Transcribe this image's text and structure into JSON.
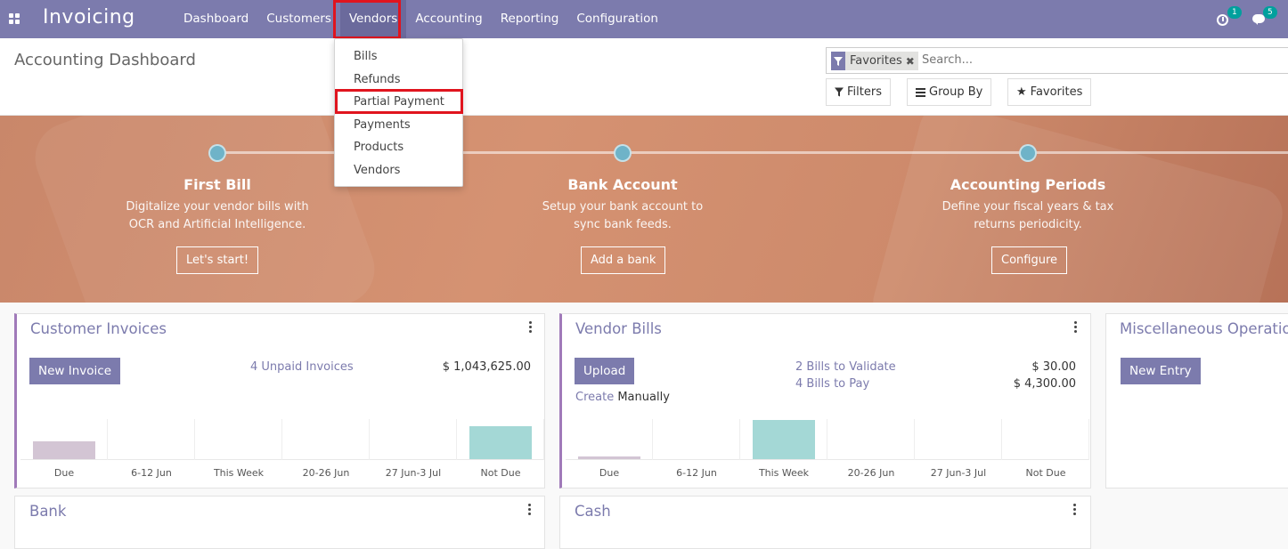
{
  "app": {
    "title": "Invoicing"
  },
  "nav": {
    "menus": [
      "Dashboard",
      "Customers",
      "Vendors",
      "Accounting",
      "Reporting",
      "Configuration"
    ],
    "activities_count": "1",
    "messages_count": "5"
  },
  "vendors_menu": {
    "items": [
      "Bills",
      "Refunds",
      "Partial Payment",
      "Payments",
      "Products",
      "Vendors"
    ]
  },
  "control_panel": {
    "title": "Accounting Dashboard",
    "facet": "Favorites",
    "search_placeholder": "Search...",
    "filters_label": "Filters",
    "groupby_label": "Group By",
    "favorites_label": "Favorites"
  },
  "onboarding": {
    "steps": [
      {
        "title": "First Bill",
        "desc1": "Digitalize your vendor bills with",
        "desc2": "OCR and Artificial Intelligence.",
        "button": "Let's start!"
      },
      {
        "title": "Bank Account",
        "desc1": "Setup your bank account to",
        "desc2": "sync bank feeds.",
        "button": "Add a bank"
      },
      {
        "title": "Accounting Periods",
        "desc1": "Define your fiscal years & tax",
        "desc2": "returns periodicity.",
        "button": "Configure"
      }
    ]
  },
  "journals": {
    "customer_invoices": {
      "title": "Customer Invoices",
      "button": "New Invoice",
      "link": "4 Unpaid Invoices",
      "amount": "$ 1,043,625.00",
      "graph_labels": [
        "Due",
        "6-12 Jun",
        "This Week",
        "20-26 Jun",
        "27 Jun-3 Jul",
        "Not Due"
      ],
      "graph_values": [
        0.45,
        0,
        0,
        0,
        0,
        0.85
      ]
    },
    "vendor_bills": {
      "title": "Vendor Bills",
      "button": "Upload",
      "create_link": "Create",
      "create_text": "Manually",
      "link1": "2 Bills to Validate",
      "amount1": "$ 30.00",
      "link2": "4 Bills to Pay",
      "amount2": "$ 4,300.00",
      "graph_labels": [
        "Due",
        "6-12 Jun",
        "This Week",
        "20-26 Jun",
        "27 Jun-3 Jul",
        "Not Due"
      ],
      "graph_values": [
        0.06,
        0,
        1.0,
        0,
        0,
        0
      ]
    },
    "misc": {
      "title": "Miscellaneous Operations",
      "button": "New Entry"
    },
    "bank": {
      "title": "Bank"
    },
    "cash": {
      "title": "Cash"
    }
  },
  "colors": {
    "brand": "#7c7bad",
    "highlight": "#e0141e",
    "past_bar": "#d3c5d4",
    "future_bar": "#a4d8d6"
  }
}
